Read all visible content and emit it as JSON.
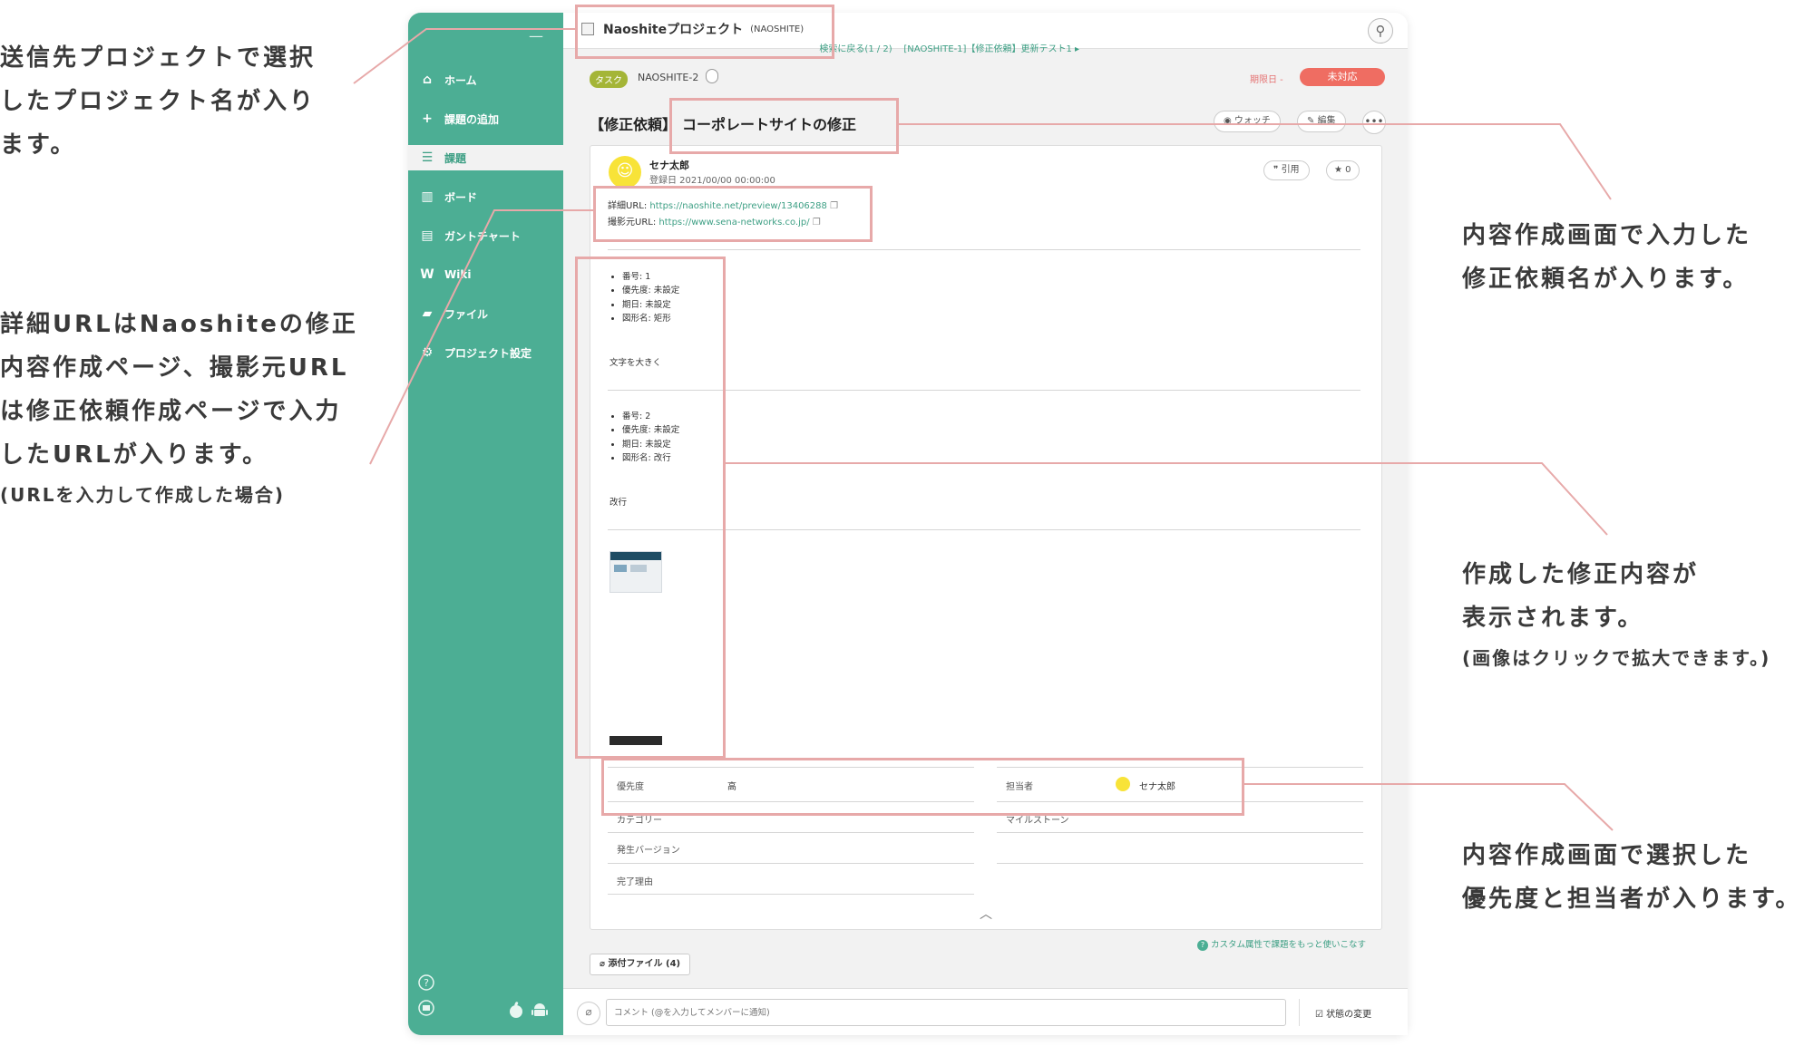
{
  "annotations": {
    "project": [
      "送信先プロジェクトで選択",
      "したプロジェクト名が入り",
      "ます。"
    ],
    "title": [
      "内容作成画面で入力した",
      "修正依頼名が入ります。"
    ],
    "url": [
      "詳細URLはNaoshiteの修正",
      "内容作成ページ、撮影元URL",
      "は修正依頼作成ページで入力",
      "したURLが入ります。"
    ],
    "url_note": "(URLを入力して作成した場合)",
    "content": [
      "作成した修正内容が",
      "表示されます。"
    ],
    "content_note": "(画像はクリックで拡大できます。)",
    "props": [
      "内容作成画面で選択した",
      "優先度と担当者が入ります。"
    ]
  },
  "sidebar": {
    "items": [
      {
        "icon": "home-icon",
        "glyph": "⌂",
        "label": "ホーム"
      },
      {
        "icon": "plus-icon",
        "glyph": "+",
        "label": "課題の追加"
      },
      {
        "icon": "list-icon",
        "glyph": "☰",
        "label": "課題"
      },
      {
        "icon": "board-icon",
        "glyph": "▥",
        "label": "ボード"
      },
      {
        "icon": "gantt-icon",
        "glyph": "▤",
        "label": "ガントチャート"
      },
      {
        "icon": "wiki-icon",
        "glyph": "W",
        "label": "Wiki"
      },
      {
        "icon": "file-icon",
        "glyph": "▰",
        "label": "ファイル"
      },
      {
        "icon": "gear-icon",
        "glyph": "⚙",
        "label": "プロジェクト設定"
      }
    ],
    "active_index": 2,
    "accent": "#4cae94"
  },
  "header": {
    "project_name": "Naoshiteプロジェクト",
    "project_key": "(NAOSHITE)"
  },
  "breadcrumb": {
    "back": "検索に戻る(1 / 2)",
    "path": "[NAOSHITE-1]【修正依頼】更新テスト1 ▸"
  },
  "issue": {
    "type": "タスク",
    "key": "NAOSHITE-2",
    "due_label": "期限日 -",
    "status": "未対応",
    "title_prefix": "【修正依頼】",
    "title": "コーポレートサイトの修正",
    "watch": "ウォッチ",
    "edit": "編集",
    "more": "•••",
    "status_color": "#ef6d62",
    "type_color": "#a4b537"
  },
  "post": {
    "author": "セナ太郎",
    "created": "登録日 2021/00/00 00:00:00",
    "quote": "引用",
    "stars": "0",
    "detail_url_label": "詳細URL:",
    "detail_url": "https://naoshite.net/preview/13406288",
    "source_url_label": "撮影元URL:",
    "source_url": "https://www.sena-networks.co.jp/",
    "items": [
      {
        "lines": [
          "番号: 1",
          "優先度: 未設定",
          "期日: 未設定",
          "図形名: 矩形"
        ],
        "text": "文字を大きく"
      },
      {
        "lines": [
          "番号: 2",
          "優先度: 未設定",
          "期日: 未設定",
          "図形名: 改行"
        ],
        "text": "改行"
      }
    ]
  },
  "properties": {
    "priority_label": "優先度",
    "priority_value": "高",
    "assignee_label": "担当者",
    "assignee_value": "セナ太郎",
    "category_label": "カテゴリー",
    "milestone_label": "マイルストーン",
    "version_label": "発生バージョン",
    "resolution_label": "完了理由"
  },
  "custom_attr_link": "カスタム属性で課題をもっと使いこなす",
  "attach": "添付ファイル (4)",
  "comment": {
    "placeholder": "コメント (@を入力してメンバーに通知)",
    "status_change": "状態の変更"
  }
}
